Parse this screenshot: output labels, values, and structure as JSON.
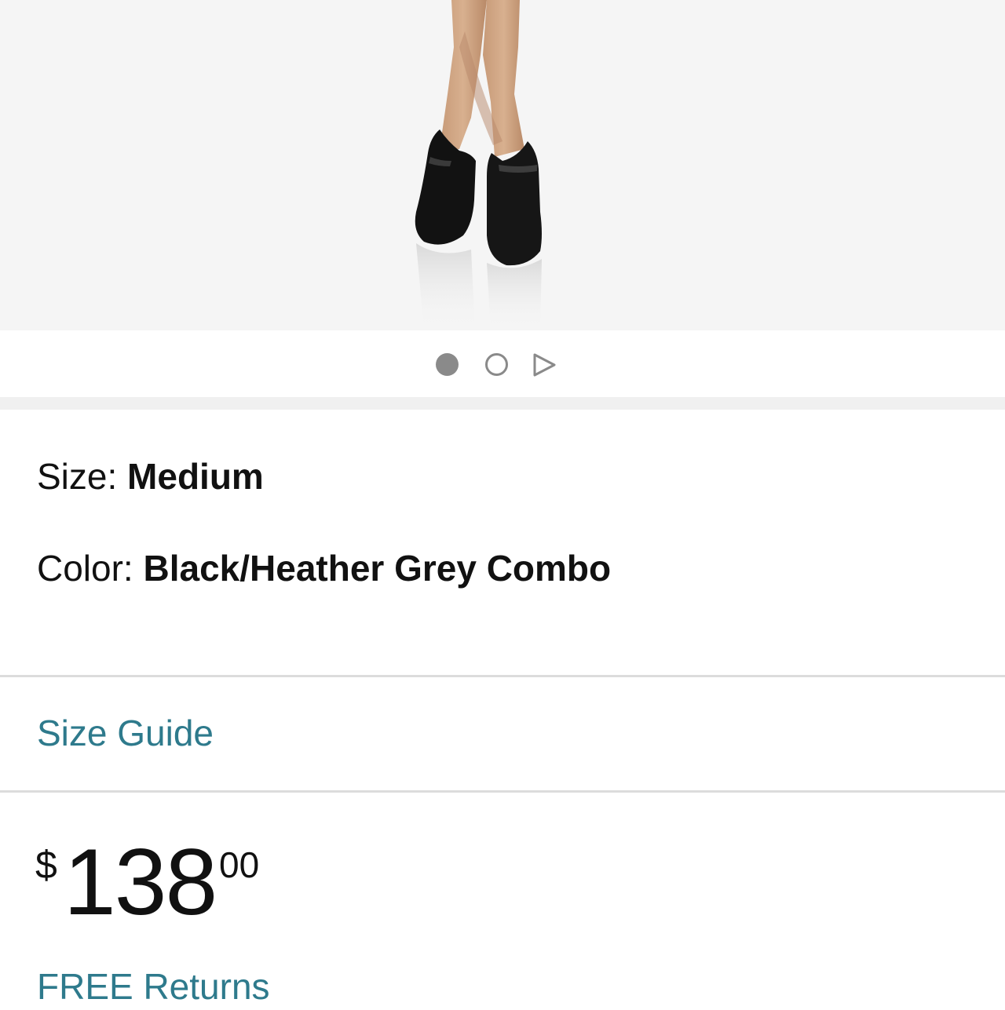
{
  "product_image": {
    "alt": "",
    "icon": "product-photo"
  },
  "carousel": {
    "current_index": 1,
    "total": 2,
    "has_video": true
  },
  "options": {
    "size_label": "Size: ",
    "size_value": "Medium",
    "color_label": "Color: ",
    "color_value": "Black/Heather Grey Combo"
  },
  "links": {
    "size_guide": "Size Guide",
    "free_returns": "FREE Returns"
  },
  "price": {
    "currency": "$",
    "whole": "138",
    "fraction": "00"
  },
  "colors": {
    "link": "#2e7a8c",
    "dot": "#8a8a8a",
    "divider": "#dcdcdc",
    "hero_bg": "#f5f5f5"
  }
}
